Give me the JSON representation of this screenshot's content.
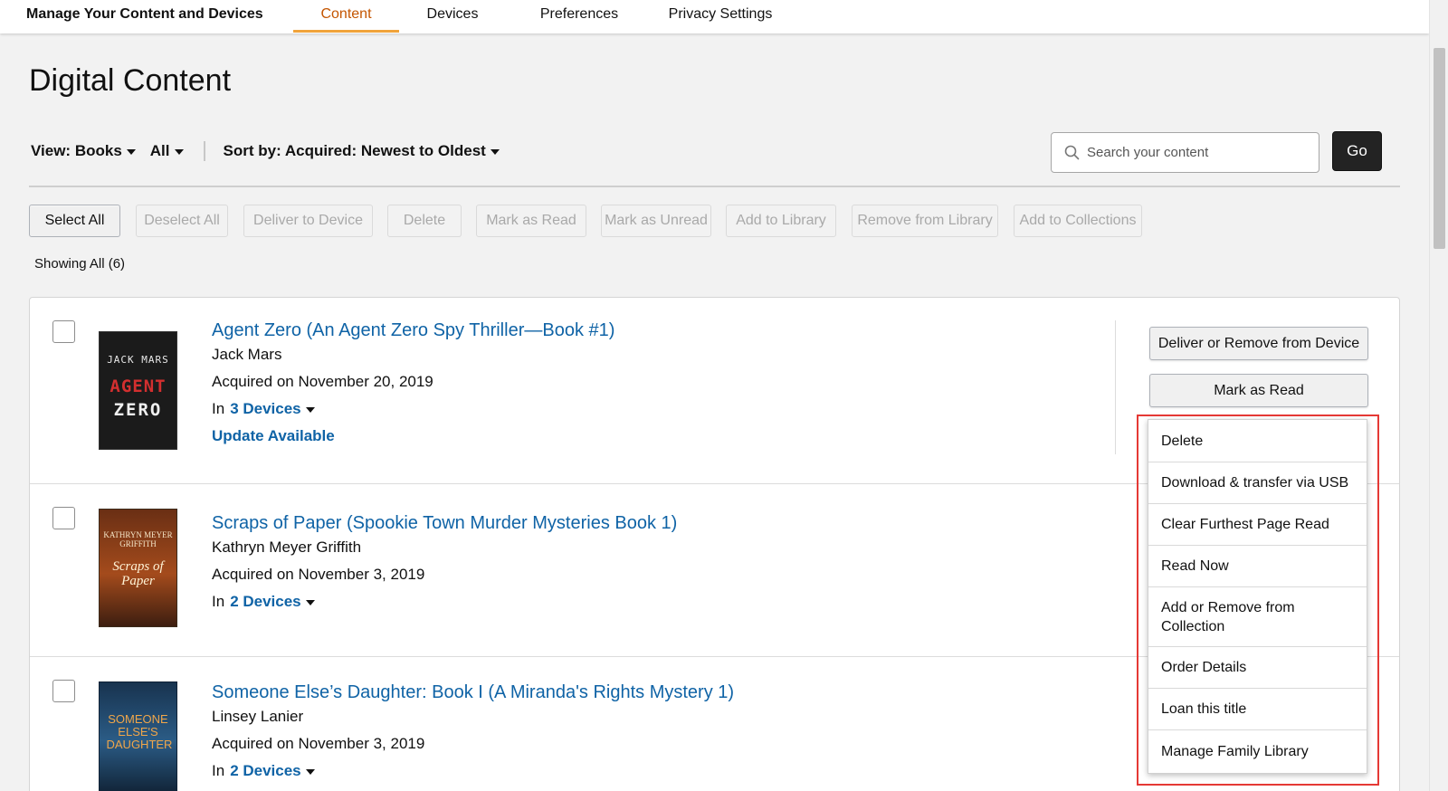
{
  "nav": {
    "app_title": "Manage Your Content and Devices",
    "tabs": [
      {
        "label": "Content",
        "active": true
      },
      {
        "label": "Devices",
        "active": false
      },
      {
        "label": "Preferences",
        "active": false
      },
      {
        "label": "Privacy Settings",
        "active": false
      }
    ]
  },
  "page_title": "Digital Content",
  "filters": {
    "view_label": "View: Books",
    "scope_label": "All",
    "sort_label": "Sort by: Acquired: Newest to Oldest"
  },
  "search": {
    "placeholder": "Search your content",
    "go_label": "Go"
  },
  "toolbar": {
    "select_all": "Select All",
    "deselect_all": "Deselect All",
    "deliver": "Deliver to Device",
    "delete": "Delete",
    "mark_read": "Mark as Read",
    "mark_unread": "Mark as Unread",
    "add_library": "Add to Library",
    "remove_library": "Remove from Library",
    "add_collections": "Add to Collections"
  },
  "showing": "Showing All (6)",
  "items": [
    {
      "title": "Agent Zero (An Agent Zero Spy Thriller—Book #1)",
      "author": "Jack Mars",
      "acquired": "Acquired on November 20, 2019",
      "in_label": "In",
      "devices": "3 Devices",
      "update": "Update Available",
      "cover_top": "JACK MARS",
      "cover_mid": "AGENT",
      "cover_bottom": "ZERO"
    },
    {
      "title": "Scraps of Paper (Spookie Town Murder Mysteries Book 1)",
      "author": "Kathryn Meyer Griffith",
      "acquired": "Acquired on November 3, 2019",
      "in_label": "In",
      "devices": "2 Devices",
      "cover_top": "KATHRYN MEYER GRIFFITH",
      "cover_mid": "Scraps of Paper"
    },
    {
      "title": "Someone Else’s Daughter: Book I (A Miranda's Rights Mystery 1)",
      "author": "Linsey Lanier",
      "acquired": "Acquired on November 3, 2019",
      "in_label": "In",
      "devices": "2 Devices",
      "cover_mid": "SOMEONE ELSE'S DAUGHTER"
    }
  ],
  "side_actions": {
    "deliver_remove": "Deliver or Remove from Device",
    "mark_read": "Mark as Read"
  },
  "menu": {
    "items": [
      "Delete",
      "Download & transfer via USB",
      "Clear Furthest Page Read",
      "Read Now",
      "Add or Remove from Collection",
      "Order Details",
      "Loan this title",
      "Manage Family Library"
    ]
  },
  "colors": {
    "link": "#0f63a6",
    "active_tab": "#c45500",
    "tab_underline": "#f0a33a",
    "highlight": "#e53935",
    "go_button": "#232323"
  }
}
